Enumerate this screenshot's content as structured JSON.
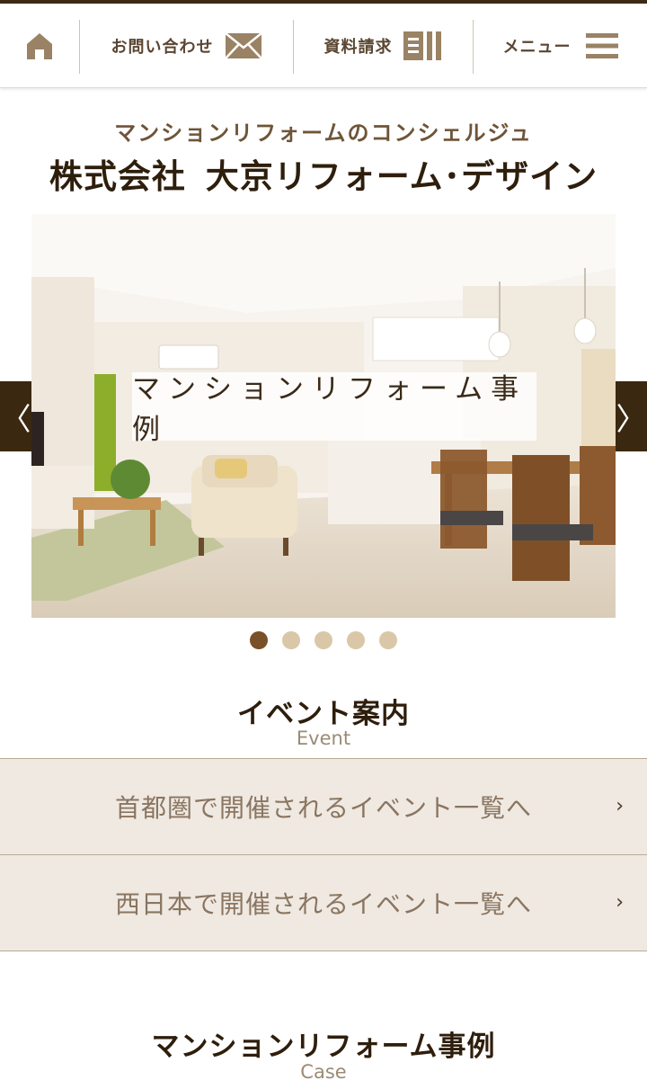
{
  "header": {
    "home_icon": "home-icon",
    "contact_label": "お問い合わせ",
    "contact_icon": "envelope-icon",
    "docs_label": "資料請求",
    "docs_icon": "document-icon",
    "menu_label": "メニュー",
    "menu_icon": "hamburger-icon"
  },
  "brand": {
    "tagline": "マンションリフォームのコンシェルジュ",
    "company_prefix": "株式会社",
    "company_name": "大京リフォーム･デザイン"
  },
  "slider": {
    "caption": "マンションリフォーム事例",
    "prev_icon": "chevron-left-icon",
    "prev_glyph": "〈",
    "next_icon": "chevron-right-icon",
    "next_glyph": "〉",
    "slide_count": 5,
    "active_index": 0
  },
  "event_section": {
    "title": "イベント案内",
    "subtitle": "Event",
    "links": [
      {
        "label": "首都圏で開催されるイベント一覧へ",
        "chevron": "›"
      },
      {
        "label": "西日本で開催されるイベント一覧へ",
        "chevron": "›"
      }
    ]
  },
  "case_section": {
    "title": "マンションリフォーム事例",
    "subtitle": "Case"
  },
  "colors": {
    "brand_dark": "#3d2a14",
    "accent_brown": "#7a5028",
    "dot_inactive": "#d9c7a8",
    "button_bg": "#efe9e2"
  }
}
